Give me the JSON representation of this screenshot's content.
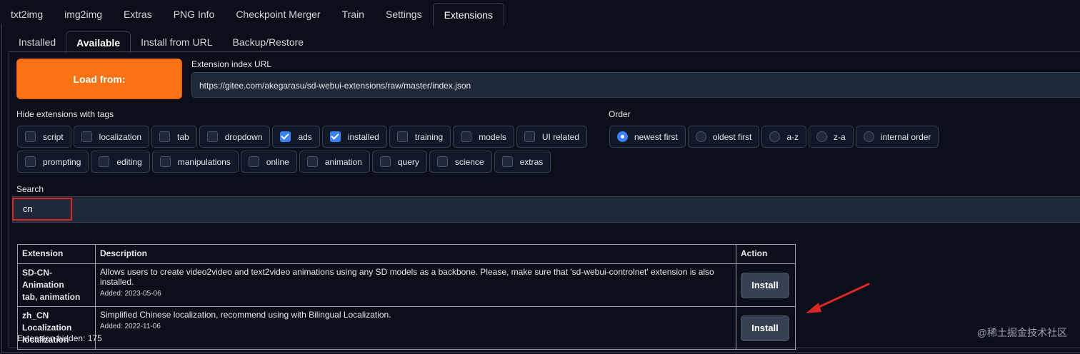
{
  "top_tabs": [
    "txt2img",
    "img2img",
    "Extras",
    "PNG Info",
    "Checkpoint Merger",
    "Train",
    "Settings",
    "Extensions"
  ],
  "active_top_tab": "Extensions",
  "sub_tabs": [
    "Installed",
    "Available",
    "Install from URL",
    "Backup/Restore"
  ],
  "active_sub_tab": "Available",
  "load_button": "Load from:",
  "index_url_label": "Extension index URL",
  "index_url_value": "https://gitee.com/akegarasu/sd-webui-extensions/raw/master/index.json",
  "hide_tags_label": "Hide extensions with tags",
  "tags_row1": [
    {
      "label": "script",
      "checked": false
    },
    {
      "label": "localization",
      "checked": false
    },
    {
      "label": "tab",
      "checked": false
    },
    {
      "label": "dropdown",
      "checked": false
    },
    {
      "label": "ads",
      "checked": true
    },
    {
      "label": "installed",
      "checked": true
    },
    {
      "label": "training",
      "checked": false
    },
    {
      "label": "models",
      "checked": false
    },
    {
      "label": "UI related",
      "checked": false
    }
  ],
  "tags_row2": [
    {
      "label": "prompting",
      "checked": false
    },
    {
      "label": "editing",
      "checked": false
    },
    {
      "label": "manipulations",
      "checked": false
    },
    {
      "label": "online",
      "checked": false
    },
    {
      "label": "animation",
      "checked": false
    },
    {
      "label": "query",
      "checked": false
    },
    {
      "label": "science",
      "checked": false
    },
    {
      "label": "extras",
      "checked": false
    }
  ],
  "order_label": "Order",
  "order_options": [
    {
      "label": "newest first",
      "selected": true
    },
    {
      "label": "oldest first",
      "selected": false
    },
    {
      "label": "a-z",
      "selected": false
    },
    {
      "label": "z-a",
      "selected": false
    },
    {
      "label": "internal order",
      "selected": false
    }
  ],
  "search_label": "Search",
  "search_value": "cn",
  "table": {
    "headers": [
      "Extension",
      "Description",
      "Action"
    ],
    "rows": [
      {
        "name": "SD-CN-Animation",
        "tags": "tab, animation",
        "description": "Allows users to create video2video and text2video animations using any SD models as a backbone. Please, make sure that 'sd-webui-controlnet' extension is also installed.",
        "added": "Added: 2023-05-06",
        "action": "Install"
      },
      {
        "name": "zh_CN Localization",
        "tags": "localization",
        "description": "Simplified Chinese localization, recommend using with Bilingual Localization.",
        "added": "Added: 2022-11-06",
        "action": "Install"
      }
    ]
  },
  "hidden_count": "Extension hidden: 175",
  "watermark": "@稀土掘金技术社区",
  "colors": {
    "accent": "#f97316",
    "annotation": "#dc2626",
    "checkbox": "#3b82f6"
  }
}
